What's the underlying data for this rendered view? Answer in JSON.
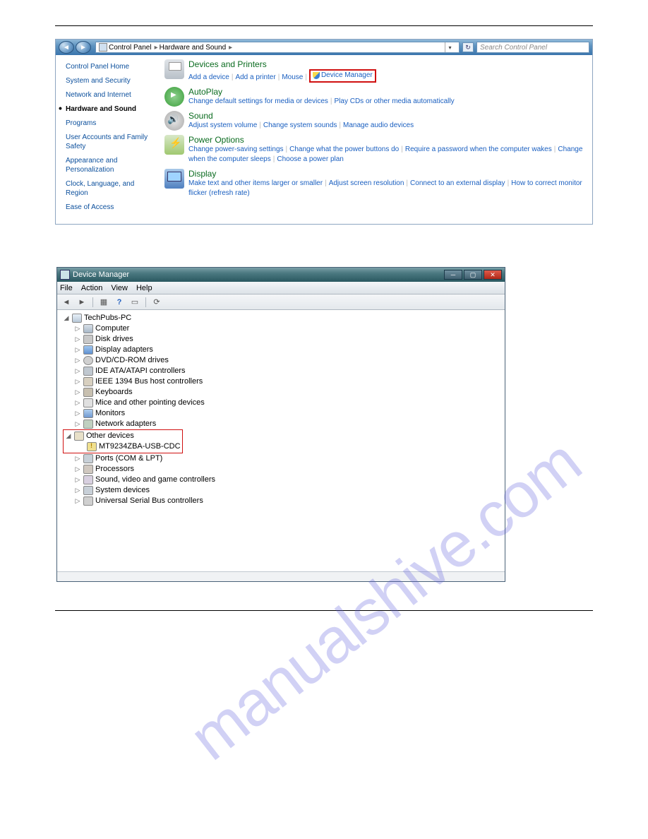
{
  "watermark": "manualshive.com",
  "controlPanel": {
    "breadcrumb": {
      "root": "Control Panel",
      "current": "Hardware and Sound"
    },
    "searchPlaceholder": "Search Control Panel",
    "sidebar": {
      "items": [
        "Control Panel Home",
        "System and Security",
        "Network and Internet",
        "Hardware and Sound",
        "Programs",
        "User Accounts and Family Safety",
        "Appearance and Personalization",
        "Clock, Language, and Region",
        "Ease of Access"
      ],
      "activeIndex": 3
    },
    "categories": [
      {
        "title": "Devices and Printers",
        "iconClass": "ic-printer",
        "links": [
          "Add a device",
          "Add a printer",
          "Mouse"
        ],
        "highlightLink": "Device Manager",
        "highlightShield": true
      },
      {
        "title": "AutoPlay",
        "iconClass": "ic-autoplay",
        "links": [
          "Change default settings for media or devices",
          "Play CDs or other media automatically"
        ]
      },
      {
        "title": "Sound",
        "iconClass": "ic-sound",
        "links": [
          "Adjust system volume",
          "Change system sounds",
          "Manage audio devices"
        ]
      },
      {
        "title": "Power Options",
        "iconClass": "ic-power",
        "links": [
          "Change power-saving settings",
          "Change what the power buttons do",
          "Require a password when the computer wakes",
          "Change when the computer sleeps",
          "Choose a power plan"
        ]
      },
      {
        "title": "Display",
        "iconClass": "ic-display",
        "links": [
          "Make text and other items larger or smaller",
          "Adjust screen resolution",
          "Connect to an external display",
          "How to correct monitor flicker (refresh rate)"
        ]
      }
    ]
  },
  "deviceManager": {
    "title": "Device Manager",
    "menus": [
      "File",
      "Action",
      "View",
      "Help"
    ],
    "rootNode": "TechPubs-PC",
    "nodes": [
      {
        "label": "Computer",
        "icon": "i-comp"
      },
      {
        "label": "Disk drives",
        "icon": "i-disk"
      },
      {
        "label": "Display adapters",
        "icon": "i-disp"
      },
      {
        "label": "DVD/CD-ROM drives",
        "icon": "i-dvd"
      },
      {
        "label": "IDE ATA/ATAPI controllers",
        "icon": "i-ide"
      },
      {
        "label": "IEEE 1394 Bus host controllers",
        "icon": "i-1394"
      },
      {
        "label": "Keyboards",
        "icon": "i-kb"
      },
      {
        "label": "Mice and other pointing devices",
        "icon": "i-mouse"
      },
      {
        "label": "Monitors",
        "icon": "i-mon"
      },
      {
        "label": "Network adapters",
        "icon": "i-net"
      }
    ],
    "highlightGroup": {
      "parent": "Other devices",
      "child": "MT9234ZBA-USB-CDC"
    },
    "nodesAfter": [
      {
        "label": "Ports (COM & LPT)",
        "icon": "i-port"
      },
      {
        "label": "Processors",
        "icon": "i-proc"
      },
      {
        "label": "Sound, video and game controllers",
        "icon": "i-sound"
      },
      {
        "label": "System devices",
        "icon": "i-sys"
      },
      {
        "label": "Universal Serial Bus controllers",
        "icon": "i-usb"
      }
    ]
  }
}
